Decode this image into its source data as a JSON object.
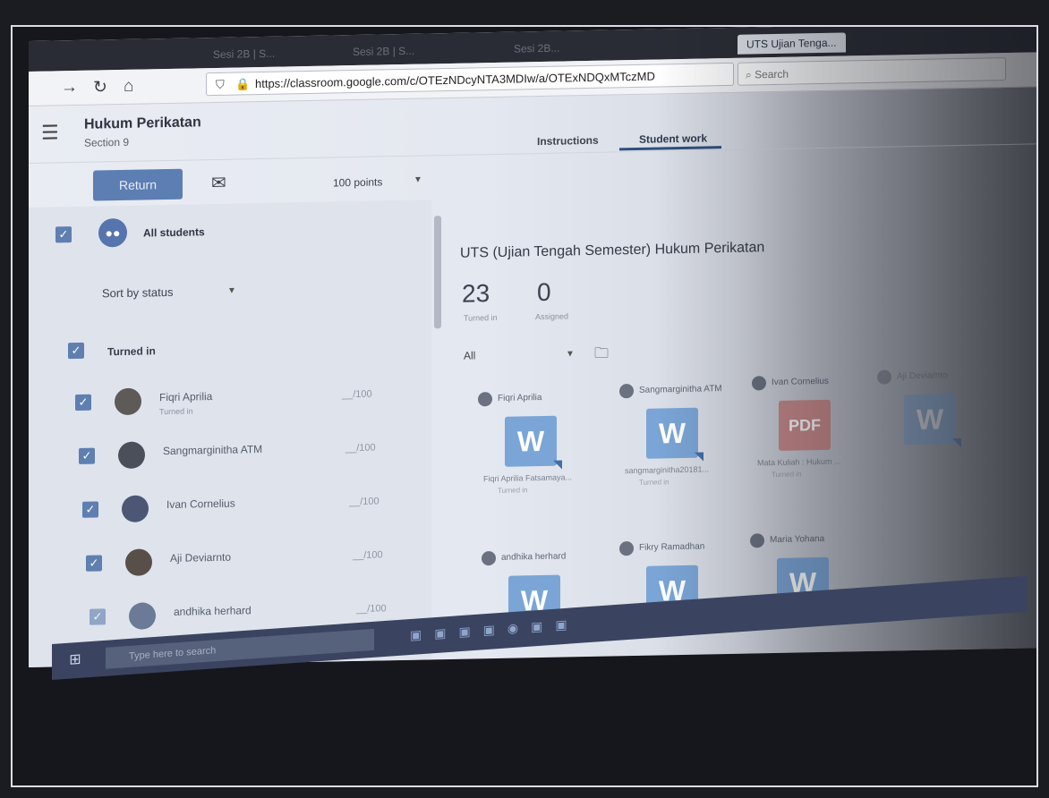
{
  "browser": {
    "tabs": [
      {
        "label": "Sesi 2B | S..."
      },
      {
        "label": "Sesi 2B | S..."
      },
      {
        "label": "Sesi 2B..."
      },
      {
        "label": "UTS Ujian Tenga..."
      }
    ],
    "url": "https://classroom.google.com/c/OTEzNDcyNTA3MDIw/a/OTExNDQxMTczMD",
    "search_placeholder": "Search"
  },
  "header": {
    "course_title": "Hukum Perikatan",
    "course_section": "Section 9",
    "tabs": [
      "Instructions",
      "Student work"
    ]
  },
  "actions": {
    "return_label": "Return",
    "points": "100 points"
  },
  "sidebar": {
    "all_students": "All students",
    "sort_label": "Sort by status",
    "group_label": "Turned in",
    "students": [
      {
        "name": "Fiqri Aprilia",
        "status": "Turned in",
        "grade": "__/100"
      },
      {
        "name": "Sangmarginitha ATM",
        "status": "",
        "grade": "__/100"
      },
      {
        "name": "Ivan Cornelius",
        "status": "",
        "grade": "__/100"
      },
      {
        "name": "Aji Deviarnto",
        "status": "",
        "grade": "__/100"
      },
      {
        "name": "andhika herhard",
        "status": "",
        "grade": "__/100"
      }
    ]
  },
  "main": {
    "assignment_title": "UTS (Ujian Tengah Semester) Hukum Perikatan",
    "turned_in_count": "23",
    "turned_in_label": "Turned in",
    "assigned_count": "0",
    "assigned_label": "Assigned",
    "filter": "All",
    "cards": [
      {
        "name": "Fiqri Aprilia",
        "file": "Fiqri Aprilia Fatsamaya...",
        "status": "Turned in",
        "type": "W"
      },
      {
        "name": "Sangmarginitha ATM",
        "file": "sangmarginitha20181...",
        "status": "Turned in",
        "type": "W"
      },
      {
        "name": "Ivan Cornelius",
        "file": "Mata Kuliah : Hukum ...",
        "status": "Turned in",
        "type": "PDF"
      },
      {
        "name": "Aji Deviarnto",
        "file": "",
        "status": "",
        "type": "W"
      },
      {
        "name": "andhika herhard",
        "file": "",
        "status": "",
        "type": "W"
      },
      {
        "name": "Fikry Ramadhan",
        "file": "",
        "status": "",
        "type": "W"
      },
      {
        "name": "Maria Yohana",
        "file": "",
        "status": "",
        "type": "W"
      }
    ]
  },
  "taskbar": {
    "search_placeholder": "Type here to search"
  }
}
